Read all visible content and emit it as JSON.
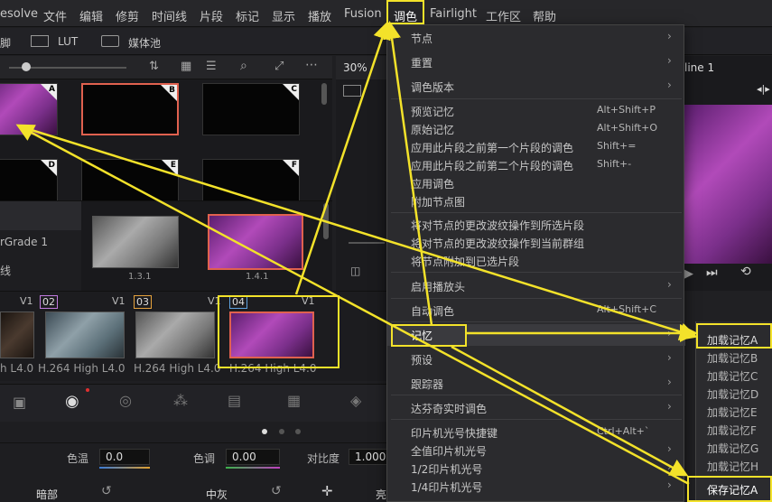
{
  "menubar": {
    "items": [
      "esolve",
      "文件",
      "编辑",
      "修剪",
      "时间线",
      "片段",
      "标记",
      "显示",
      "播放",
      "Fusion",
      "调色",
      "Fairlight",
      "工作区",
      "帮助"
    ]
  },
  "toolbar": {
    "lut_label": "LUT",
    "media_pool_label": "媒体池",
    "left_fragment": "脚",
    "zoom": "30%",
    "timeline": "line 1"
  },
  "gallery": {
    "stills": [
      {
        "label": "A"
      },
      {
        "label": "B"
      },
      {
        "label": "C"
      },
      {
        "label": "D"
      },
      {
        "label": "E"
      },
      {
        "label": "F"
      }
    ],
    "left_items": [
      "rGrade 1",
      "线"
    ],
    "strip_clips": [
      {
        "name": "1.3.1"
      },
      {
        "name": "1.4.1"
      }
    ]
  },
  "clips": [
    {
      "track": "V1",
      "num": "",
      "caption": "h L4.0"
    },
    {
      "track": "V1",
      "num": "02",
      "caption": "H.264 High L4.0"
    },
    {
      "track": "V1",
      "num": "03",
      "caption": "H.264 High L4.0"
    },
    {
      "track": "V1",
      "num": "04",
      "caption": "H.264 High L4.0"
    }
  ],
  "primaries": {
    "temp_label": "色温",
    "temp_value": "0.0",
    "tint_label": "色调",
    "tint_value": "0.00",
    "contrast_label": "对比度",
    "contrast_value": "1.000",
    "shadows_label": "暗部",
    "midtones_label": "中灰",
    "highlights_label": "亮"
  },
  "color_menu": {
    "items": [
      {
        "label": "节点",
        "shortcut": "",
        "arrow": true
      },
      {
        "label": "重置",
        "shortcut": "",
        "arrow": true
      },
      {
        "label": "调色版本",
        "shortcut": "",
        "arrow": true
      },
      {
        "label": "预览记忆",
        "shortcut": "Alt+Shift+P",
        "arrow": false
      },
      {
        "label": "原始记忆",
        "shortcut": "Alt+Shift+O",
        "arrow": false
      },
      {
        "label": "应用此片段之前第一个片段的调色",
        "shortcut": "Shift+=",
        "arrow": false
      },
      {
        "label": "应用此片段之前第二个片段的调色",
        "shortcut": "Shift+-",
        "arrow": false
      },
      {
        "label": "应用调色",
        "shortcut": "",
        "arrow": false
      },
      {
        "label": "附加节点图",
        "shortcut": "",
        "arrow": false
      },
      {
        "label": "将对节点的更改波纹操作到所选片段",
        "shortcut": "",
        "arrow": false
      },
      {
        "label": "将对节点的更改波纹操作到当前群组",
        "shortcut": "",
        "arrow": false
      },
      {
        "label": "将节点附加到已选片段",
        "shortcut": "",
        "arrow": false
      },
      {
        "label": "启用播放头",
        "shortcut": "",
        "arrow": true
      },
      {
        "label": "自动调色",
        "shortcut": "Alt+Shift+C",
        "arrow": false
      },
      {
        "label": "记忆",
        "shortcut": "",
        "arrow": true
      },
      {
        "label": "预设",
        "shortcut": "",
        "arrow": true
      },
      {
        "label": "跟踪器",
        "shortcut": "",
        "arrow": true
      },
      {
        "label": "达芬奇实时调色",
        "shortcut": "",
        "arrow": true
      },
      {
        "label": "印片机光号快捷键",
        "shortcut": "Ctrl+Alt+`",
        "arrow": false
      },
      {
        "label": "全值印片机光号",
        "shortcut": "",
        "arrow": true
      },
      {
        "label": "1/2印片机光号",
        "shortcut": "",
        "arrow": true
      },
      {
        "label": "1/4印片机光号",
        "shortcut": "",
        "arrow": true
      }
    ]
  },
  "memory_submenu": {
    "items": [
      "加载记忆A",
      "加载记忆B",
      "加载记忆C",
      "加载记忆D",
      "加载记忆E",
      "加载记忆F",
      "加载记忆G",
      "加载记忆H",
      "保存记忆A"
    ]
  },
  "colors": {
    "annotation": "#f3e22a",
    "selected_still": "#e0614f",
    "menu_bg": "#2b2b2e"
  }
}
